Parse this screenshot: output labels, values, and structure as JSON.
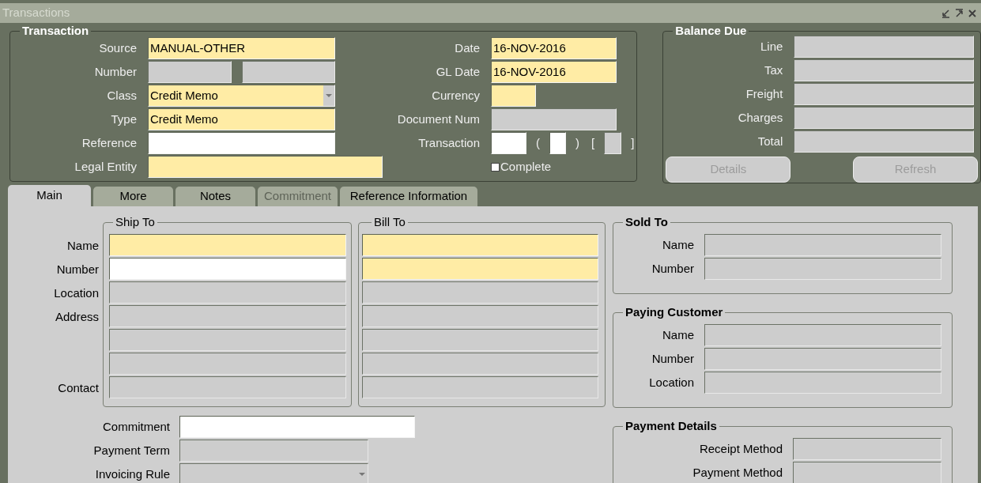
{
  "window": {
    "title": "Transactions"
  },
  "transaction": {
    "title": "Transaction",
    "left": [
      {
        "label": "Source",
        "boxes": [
          {
            "kind": "text",
            "required": true,
            "readonly": false,
            "value": "MANUAL-OTHER"
          }
        ]
      },
      {
        "label": "Number",
        "boxes": [
          {
            "kind": "text",
            "required": false,
            "readonly": true
          },
          {
            "kind": "text",
            "required": false,
            "readonly": true
          }
        ]
      },
      {
        "label": "Class",
        "boxes": [
          {
            "kind": "list",
            "required": true,
            "readonly": false,
            "value": "Credit Memo"
          }
        ]
      },
      {
        "label": "Type",
        "boxes": [
          {
            "kind": "text",
            "required": true,
            "readonly": false,
            "value": "Credit Memo"
          }
        ]
      },
      {
        "label": "Reference",
        "boxes": [
          {
            "kind": "text",
            "required": false,
            "readonly": false
          }
        ]
      },
      {
        "label": "Legal Entity",
        "boxes": [
          {
            "kind": "text",
            "required": true,
            "readonly": false
          }
        ]
      }
    ],
    "right": [
      {
        "label": "Date",
        "boxes": [
          {
            "kind": "text",
            "required": true,
            "readonly": false,
            "value": "16-NOV-2016"
          }
        ]
      },
      {
        "label": "GL Date",
        "boxes": [
          {
            "kind": "text",
            "required": true,
            "readonly": false,
            "value": "16-NOV-2016"
          }
        ]
      },
      {
        "label": "Currency",
        "boxes": [
          {
            "kind": "text",
            "required": true,
            "readonly": false
          }
        ]
      },
      {
        "label": "Document Num",
        "boxes": [
          {
            "kind": "text",
            "required": false,
            "readonly": true
          }
        ]
      },
      {
        "label": "Transaction",
        "boxes": [
          {
            "kind": "text",
            "required": false,
            "readonly": false
          },
          {
            "kind": "symbol",
            "text": "("
          },
          {
            "kind": "text",
            "required": false,
            "readonly": false
          },
          {
            "kind": "symbol",
            "text": ")"
          },
          {
            "kind": "symbol",
            "text": "["
          },
          {
            "kind": "text",
            "required": false,
            "readonly": true
          },
          {
            "kind": "symbol",
            "text": "]"
          }
        ]
      }
    ],
    "complete": {
      "label": "Complete",
      "checked": false
    }
  },
  "balance_due": {
    "title": "Balance Due",
    "fields": [
      {
        "label": "Line",
        "required": false,
        "readonly": true
      },
      {
        "label": "Tax",
        "required": false,
        "readonly": true
      },
      {
        "label": "Freight",
        "required": false,
        "readonly": true
      },
      {
        "label": "Charges",
        "required": false,
        "readonly": true
      },
      {
        "label": "Total",
        "required": false,
        "readonly": true
      }
    ],
    "buttons": [
      {
        "label": "Details",
        "disabled": true
      },
      {
        "label": "Refresh",
        "disabled": true
      }
    ]
  },
  "tabs": [
    {
      "label": "Main",
      "selected": true,
      "disabled": false
    },
    {
      "label": "More",
      "selected": false,
      "disabled": false
    },
    {
      "label": "Notes",
      "selected": false,
      "disabled": false
    },
    {
      "label": "Commitment",
      "selected": false,
      "disabled": true
    },
    {
      "label": "Reference Information",
      "selected": false,
      "disabled": false
    }
  ],
  "address": {
    "ship_to_title": "Ship To",
    "bill_to_title": "Bill To",
    "rows": [
      {
        "label": "Name",
        "ship_to": {
          "required": true,
          "readonly": false
        },
        "bill_to": {
          "required": true,
          "readonly": false
        }
      },
      {
        "label": "Number",
        "ship_to": {
          "required": false,
          "readonly": false
        },
        "bill_to": {
          "required": true,
          "readonly": false
        }
      },
      {
        "label": "Location",
        "ship_to": {
          "required": false,
          "readonly": true
        },
        "bill_to": {
          "required": false,
          "readonly": true
        }
      },
      {
        "label": "Address",
        "ship_to": {
          "required": false,
          "readonly": true
        },
        "bill_to": {
          "required": false,
          "readonly": true
        }
      },
      {
        "ship_to": {
          "required": false,
          "readonly": true
        },
        "bill_to": {
          "required": false,
          "readonly": true
        }
      },
      {
        "ship_to": {
          "required": false,
          "readonly": true
        },
        "bill_to": {
          "required": false,
          "readonly": true
        }
      },
      {
        "label": "Contact",
        "ship_to": {
          "required": false,
          "readonly": true
        },
        "bill_to": {
          "required": false,
          "readonly": true
        }
      }
    ]
  },
  "terms": [
    {
      "label": "Commitment",
      "kind": "text",
      "required": false,
      "readonly": false
    },
    {
      "label": "Payment Term",
      "kind": "text",
      "required": false,
      "readonly": true
    },
    {
      "label": "Invoicing Rule",
      "kind": "list",
      "required": false,
      "readonly": true
    }
  ],
  "sold_to": {
    "title": "Sold To",
    "fields": [
      {
        "label": "Name",
        "required": false,
        "readonly": true
      },
      {
        "label": "Number",
        "required": false,
        "readonly": true
      }
    ]
  },
  "paying_customer": {
    "title": "Paying Customer",
    "fields": [
      {
        "label": "Name",
        "required": false,
        "readonly": true
      },
      {
        "label": "Number",
        "required": false,
        "readonly": true
      },
      {
        "label": "Location",
        "required": false,
        "readonly": true
      }
    ]
  },
  "payment_details": {
    "title": "Payment Details",
    "fields": [
      {
        "label": "Receipt Method",
        "required": false,
        "readonly": true
      },
      {
        "label": "Payment Method",
        "required": false,
        "readonly": true
      }
    ]
  }
}
